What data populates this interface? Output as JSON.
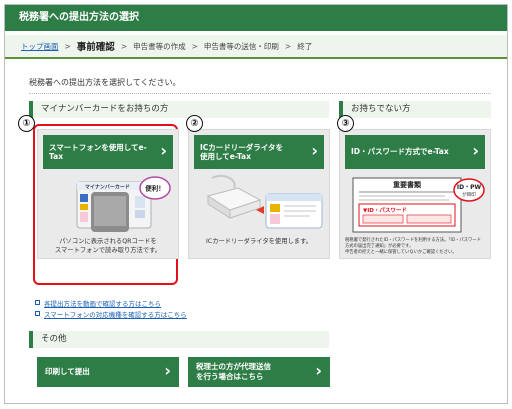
{
  "title": "税務署への提出方法の選択",
  "breadcrumb": {
    "home": "トップ画面",
    "current": "事前確認",
    "step3": "申告書等の作成",
    "step4": "申告書等の送信・印刷",
    "step5": "終了"
  },
  "intro": "税務署への提出方法を選択してください。",
  "sections": {
    "mynumber": "マイナンバーカードをお持ちの方",
    "no_card": "お持ちでない方",
    "other": "その他"
  },
  "markers": [
    "①",
    "②",
    "③"
  ],
  "cards": [
    {
      "button_line1": "スマートフォンを使用してe-Tax",
      "button_line2": "",
      "desc_line1": "パソコンに表示されるQRコードを",
      "desc_line2": "スマートフォンで読み取り方法です。",
      "illus_card_label": "マイナンバーカード",
      "illus_badge": "便利！"
    },
    {
      "button_line1": "ICカードリーダライタを",
      "button_line2": "使用してe-Tax",
      "desc_line1": "ICカードリーダライタを使用します。",
      "desc_line2": ""
    },
    {
      "button_line1": "ID・パスワード方式でe-Tax",
      "button_line2": "",
      "desc_line1": "税務署で発行されたID・パスワードを利用する方法。「ID・パスワード方式の届出完了通知」が必要です。",
      "desc_line2": "申告者の控えと一緒に保管していないかご確認ください。",
      "illus_doc_title": "重要書類",
      "illus_badge_line1": "ID・PW",
      "illus_badge_line2": "が目印",
      "illus_idpw": "▼ID・パスワード"
    }
  ],
  "links": [
    "各提出方法を動画で確認する方はこちら",
    "スマートフォンの対応機種を確認する方はこちら"
  ],
  "other_buttons": {
    "print": "印刷して提出",
    "proxy_line1": "税理士の方が代理送信",
    "proxy_line2": "を行う場合はこちら"
  },
  "colors": {
    "brand_green": "#2e7d46",
    "highlight_red": "#e3101c",
    "link_blue": "#1a5fb4"
  }
}
